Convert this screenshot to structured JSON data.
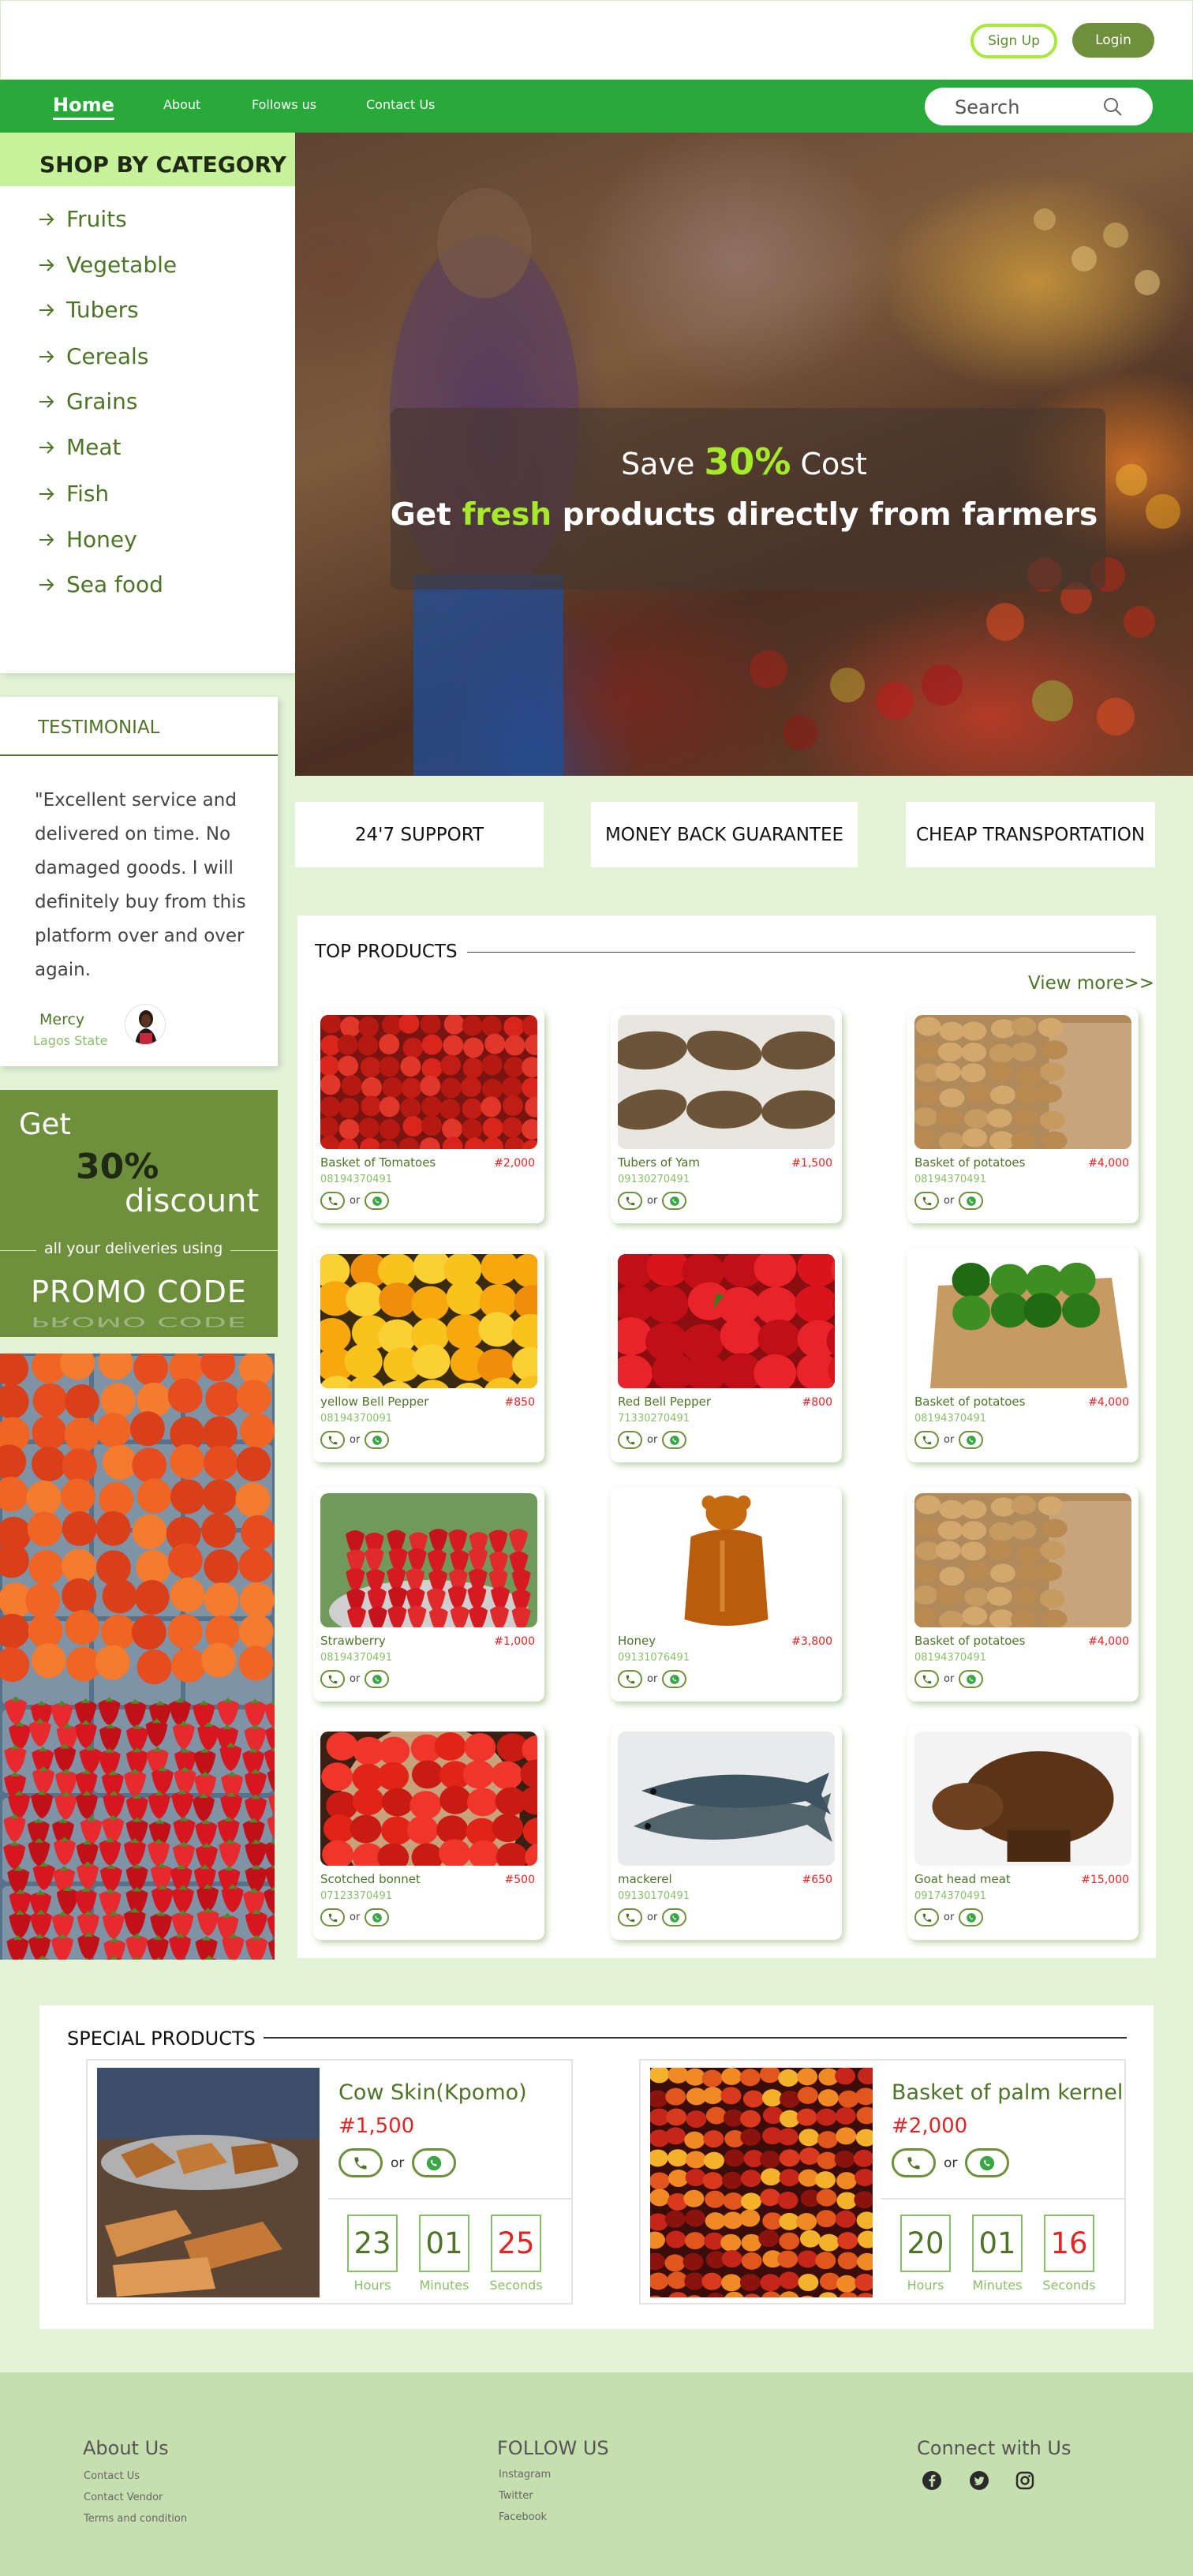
{
  "header": {
    "signup_label": "Sign Up",
    "login_label": "Login"
  },
  "nav": {
    "items": [
      "Home",
      "About",
      "Follows us",
      "Contact Us"
    ],
    "search_placeholder": "Search"
  },
  "categories": {
    "title": "SHOP BY CATEGORY",
    "items": [
      "Fruits",
      "Vegetable",
      "Tubers",
      "Cereals",
      "Grains",
      "Meat",
      "Fish",
      "Honey",
      "Sea food"
    ]
  },
  "hero": {
    "line1_pre": "Save",
    "line1_pct": "30%",
    "line1_post": "Cost",
    "line2_pre": "Get",
    "line2_fresh": "fresh",
    "line2_post": "products directly from farmers"
  },
  "features": [
    "24'7 SUPPORT",
    "MONEY BACK GUARANTEE",
    "CHEAP TRANSPORTATION"
  ],
  "testimonial": {
    "title": "TESTIMONIAL",
    "quote": "\"Excellent service  and delivered on time. No damaged goods. I will definitely buy from this platform over and over again.",
    "name": "Mercy",
    "location": "Lagos State"
  },
  "promo": {
    "get": "Get",
    "pct": "30%",
    "discount": "discount",
    "subtitle": "all your deliveries using",
    "code": "PROMO CODE"
  },
  "top_products": {
    "title": "TOP PRODUCTS",
    "view_more": "View more>>",
    "or_text": "or",
    "items": [
      {
        "name": "Basket of Tomatoes",
        "price": "#2,000",
        "phone": "08194370491"
      },
      {
        "name": "Tubers of Yam",
        "price": "#1,500",
        "phone": "09130270491"
      },
      {
        "name": "Basket of potatoes",
        "price": "#4,000",
        "phone": "08194370491"
      },
      {
        "name": "yellow Bell Pepper",
        "price": "#850",
        "phone": "08194370091"
      },
      {
        "name": "Red Bell Pepper",
        "price": "#800",
        "phone": "71330270491"
      },
      {
        "name": "Basket of potatoes",
        "price": "#4,000",
        "phone": "08194370491"
      },
      {
        "name": "Strawberry",
        "price": "#1,000",
        "phone": "08194370491"
      },
      {
        "name": "Honey",
        "price": "#3,800",
        "phone": "09131076491"
      },
      {
        "name": "Basket of potatoes",
        "price": "#4,000",
        "phone": "08194370491"
      },
      {
        "name": "Scotched bonnet",
        "price": "#500",
        "phone": "07123370491"
      },
      {
        "name": "mackerel",
        "price": "#650",
        "phone": "09130170491"
      },
      {
        "name": "Goat head meat",
        "price": "#15,000",
        "phone": "09174370491"
      }
    ]
  },
  "special_products": {
    "title": "SPECIAL PRODUCTS",
    "or_text": "or",
    "items": [
      {
        "name": "Cow Skin(Kpomo)",
        "price": "#1,500",
        "hours": "23",
        "minutes": "01",
        "seconds": "25"
      },
      {
        "name": "Basket of palm kernel",
        "price": "#2,000",
        "hours": "20",
        "minutes": "01",
        "seconds": "16"
      }
    ],
    "labels": {
      "hours": "Hours",
      "minutes": "Minutes",
      "seconds": "Seconds"
    }
  },
  "footer": {
    "about": {
      "title": "About Us",
      "links": [
        "Contact Us",
        "Contact Vendor",
        "Terms and condition"
      ]
    },
    "follow": {
      "title": "FOLLOW US",
      "links": [
        "Instagram",
        "Twitter",
        "Facebook"
      ]
    },
    "connect": {
      "title": "Connect with Us",
      "icons": [
        "facebook-icon",
        "twitter-icon",
        "instagram-icon"
      ]
    }
  },
  "colors": {
    "primary_green": "#28a93a",
    "olive": "#6e8f3b",
    "light_green": "#c7f29b",
    "price_red": "#e32424",
    "page_bg": "#e2f3d6",
    "footer_bg": "#c6dfae"
  }
}
